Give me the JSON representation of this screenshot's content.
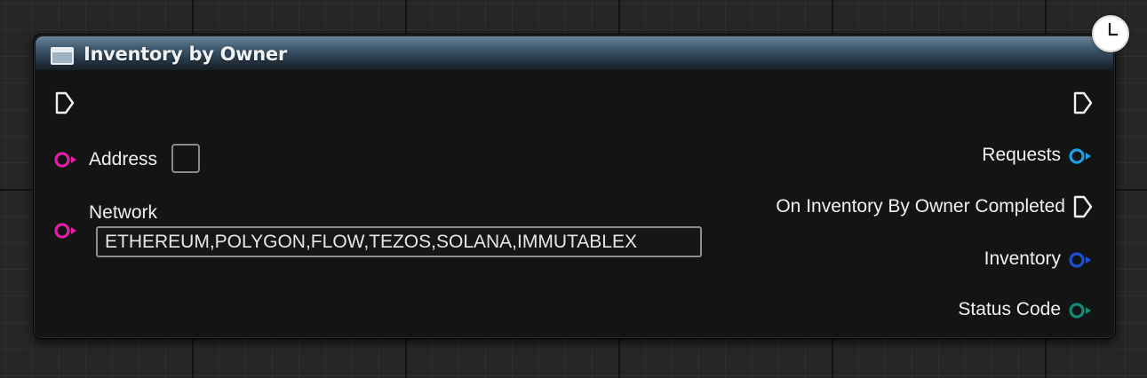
{
  "node": {
    "title": "Inventory by Owner",
    "header_icon": "function-node-icon",
    "latent_icon": "clock-icon",
    "header_color": "#3f5a70"
  },
  "inputs": {
    "exec_icon": "exec-input-pin-icon",
    "address": {
      "label": "Address",
      "pin_color": "#e21ea6",
      "value": ""
    },
    "network": {
      "label": "Network",
      "pin_color": "#e21ea6",
      "value": "ETHEREUM,POLYGON,FLOW,TEZOS,SOLANA,IMMUTABLEX"
    }
  },
  "outputs": {
    "exec_icon": "exec-output-pin-icon",
    "requests": {
      "label": "Requests",
      "pin_color": "#1aa0e6"
    },
    "on_completed": {
      "label": "On Inventory By Owner Completed"
    },
    "inventory": {
      "label": "Inventory",
      "pin_color": "#1c4fd6"
    },
    "status_code": {
      "label": "Status Code",
      "pin_color": "#168a76"
    }
  }
}
